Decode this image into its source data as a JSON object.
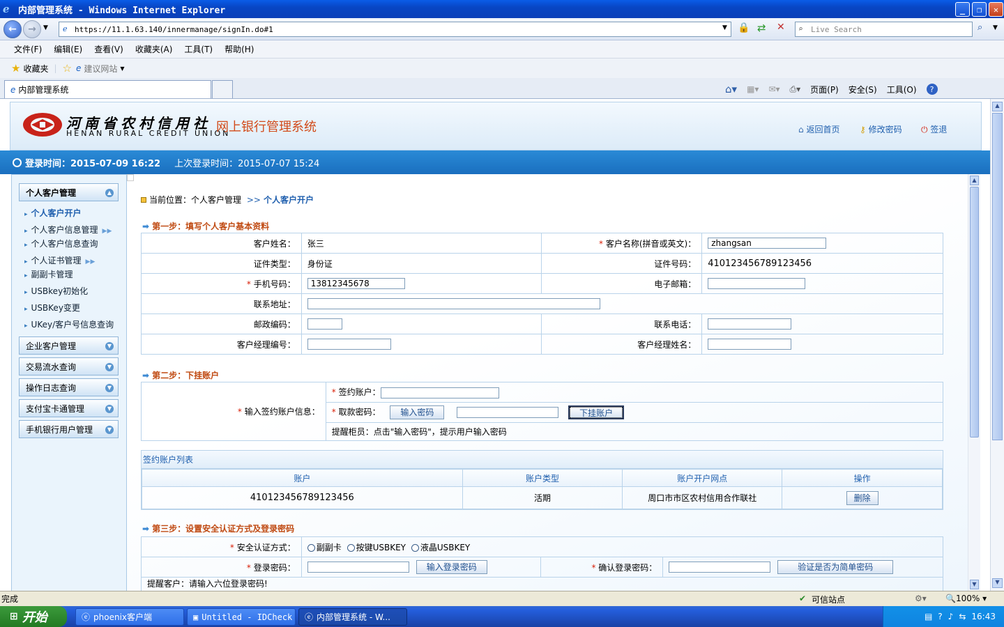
{
  "window": {
    "title": "内部管理系统 - Windows Internet Explorer",
    "address": "https://11.1.63.140/innermanage/signIn.do#1",
    "search_placeholder": "Live Search",
    "menu": [
      "文件(F)",
      "编辑(E)",
      "查看(V)",
      "收藏夹(A)",
      "工具(T)",
      "帮助(H)"
    ],
    "favorites_label": "收藏夹",
    "suggested_sites": "建议网站",
    "tab_title": "内部管理系统",
    "commands": [
      "页面(P)",
      "安全(S)",
      "工具(O)"
    ]
  },
  "header": {
    "bank_cn": "河南省农村信用社",
    "bank_en": "HENAN RURAL CREDIT UNION",
    "system_title": "网上银行管理系统",
    "links": {
      "home": "返回首页",
      "password": "修改密码",
      "logout": "签退"
    }
  },
  "infobar": {
    "login_time": "登录时间：2015-07-09 16:22",
    "last_login": "上次登录时间：2015-07-07 15:24"
  },
  "sidebar": {
    "sections": [
      {
        "label": "个人客户管理",
        "expanded": true
      },
      {
        "label": "企业客户管理"
      },
      {
        "label": "交易流水查询"
      },
      {
        "label": "操作日志查询"
      },
      {
        "label": "支付宝卡通管理"
      },
      {
        "label": "手机银行用户管理"
      }
    ],
    "items": [
      {
        "label": "个人客户开户"
      },
      {
        "label": "个人客户信息管理"
      },
      {
        "label": "个人客户信息查询"
      },
      {
        "label": "个人证书管理"
      },
      {
        "label": "副副卡管理"
      },
      {
        "label": "USBkey初始化"
      },
      {
        "label": "USBKey变更"
      },
      {
        "label": "UKey/客户号信息查询"
      }
    ]
  },
  "breadcrumb": {
    "prefix": "当前位置：个人客户管理",
    "sep": ">>",
    "current": "个人客户开户"
  },
  "step1": {
    "title": "第一步：填写个人客户基本资料",
    "name_label": "客户姓名：",
    "name_value": "张三",
    "pinyin_label": "客户名称(拼音或英文)：",
    "pinyin_value": "zhangsan",
    "idtype_label": "证件类型：",
    "idtype_value": "身份证",
    "idno_label": "证件号码：",
    "idno_value": "410123456789123456",
    "mobile_label": "手机号码：",
    "mobile_value": "13812345678",
    "email_label": "电子邮箱：",
    "email_value": "",
    "address_label": "联系地址：",
    "address_value": "",
    "zip_label": "邮政编码：",
    "zip_value": "",
    "phone_label": "联系电话：",
    "phone_value": "",
    "mgrno_label": "客户经理编号：",
    "mgrno_value": "",
    "mgrname_label": "客户经理姓名：",
    "mgrname_value": ""
  },
  "step2": {
    "title": "第二步：下挂账户",
    "info_label": "输入签约账户信息：",
    "account_label": "签约账户：",
    "account_value": "",
    "pwd_label": "取款密码：",
    "enter_pwd_button": "输入密码",
    "pwd_value": "",
    "attach_button": "下挂账户",
    "hint": "提醒柜员：点击\"输入密码\"，提示用户输入密码"
  },
  "account_list": {
    "caption": "签约账户列表",
    "columns": [
      "账户",
      "账户类型",
      "账户开户网点",
      "操作"
    ],
    "rows": [
      {
        "account": "410123456789123456",
        "type": "活期",
        "branch": "周口市市区农村信用合作联社",
        "action": "删除"
      }
    ]
  },
  "step3": {
    "title": "第三步：设置安全认证方式及登录密码",
    "auth_label": "安全认证方式：",
    "auth_options": [
      "副副卡",
      "按键USBKEY",
      "液晶USBKEY"
    ],
    "login_pwd_label": "登录密码：",
    "login_pwd_button": "输入登录密码",
    "confirm_pwd_label": "确认登录密码：",
    "verify_button": "验证是否为简单密码",
    "hint": "提醒客户：请输入六位登录密码!"
  },
  "statusbar": {
    "left": "完成",
    "trusted": "可信站点",
    "zoom": "100%"
  },
  "taskbar": {
    "start": "开始",
    "tasks": [
      "phoenix客户端",
      "Untitled - IDCheck",
      "内部管理系统 - W..."
    ],
    "clock": "16:43"
  }
}
